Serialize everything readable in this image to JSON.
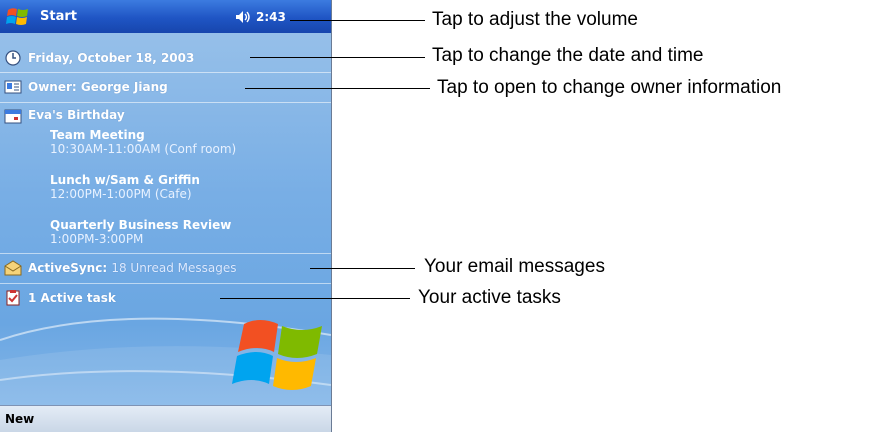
{
  "titlebar": {
    "start_label": "Start",
    "clock": "2:43"
  },
  "today": {
    "date": "Friday, October 18, 2003",
    "owner": "Owner: George Jiang",
    "calendar": {
      "header": "Eva's Birthday",
      "appointments": [
        {
          "title": "Team Meeting",
          "detail": "10:30AM-11:00AM (Conf room)"
        },
        {
          "title": "Lunch w/Sam & Griffin",
          "detail": "12:00PM-1:00PM (Cafe)"
        },
        {
          "title": "Quarterly Business Review",
          "detail": "1:00PM-3:00PM"
        }
      ]
    },
    "activesync": {
      "label": "ActiveSync:",
      "detail": "18 Unread Messages"
    },
    "tasks": "1 Active task"
  },
  "menubar": {
    "new_label": "New"
  },
  "callouts": {
    "volume": "Tap to adjust the volume",
    "datetime": "Tap to change the date and time",
    "owner": "Tap to open to change owner information",
    "email": "Your email messages",
    "tasks": "Your active tasks"
  },
  "colors": {
    "titlebar": "#1f55c4",
    "today_background": "#78aee5",
    "menubar": "#d5dfec"
  }
}
